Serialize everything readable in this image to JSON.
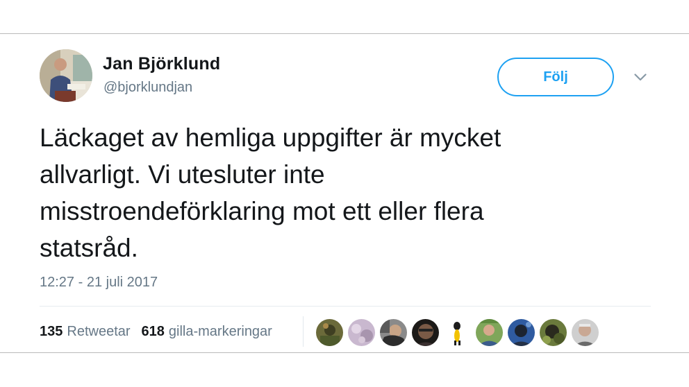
{
  "tweet": {
    "author_name": "Jan Björklund",
    "author_handle": "@bjorklundjan",
    "follow_label": "Följ",
    "text_lines": [
      "Läckaget av hemliga uppgifter är mycket",
      "allvarligt. Vi utesluter inte",
      "misstroendeförklaring mot ett eller flera",
      "statsråd."
    ],
    "timestamp": "12:27 - 21 juli 2017",
    "retweets": {
      "count": "135",
      "label": "Retweetar"
    },
    "likes": {
      "count": "618",
      "label": "gilla-markeringar"
    }
  },
  "colors": {
    "accent": "#1da1f2",
    "text": "#14171a",
    "muted": "#657786"
  },
  "icons": {
    "menu_chevron": "chevron-down-icon"
  },
  "liker_avatars": [
    {
      "name": "liker-avatar-1"
    },
    {
      "name": "liker-avatar-2"
    },
    {
      "name": "liker-avatar-3"
    },
    {
      "name": "liker-avatar-4"
    },
    {
      "name": "liker-avatar-5"
    },
    {
      "name": "liker-avatar-6"
    },
    {
      "name": "liker-avatar-7"
    },
    {
      "name": "liker-avatar-8"
    },
    {
      "name": "liker-avatar-9"
    }
  ]
}
